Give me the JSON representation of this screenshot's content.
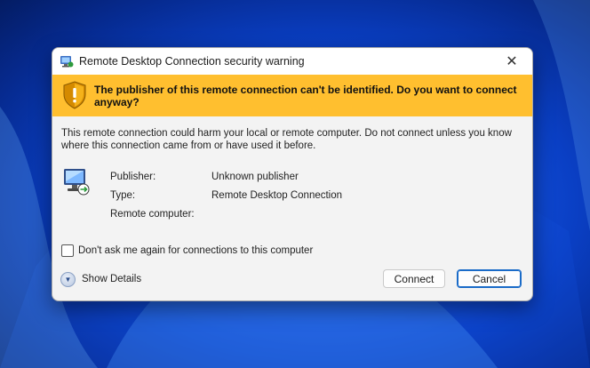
{
  "dialog": {
    "title": "Remote Desktop Connection security warning",
    "close_glyph": "✕",
    "banner_text": "The publisher of this remote connection can't be identified. Do you want to connect anyway?",
    "body_text": "This remote connection could harm your local or remote computer. Do not connect unless you know where this connection came from or have used it before.",
    "details": [
      {
        "label": "Publisher:",
        "value": "Unknown publisher"
      },
      {
        "label": "Type:",
        "value": "Remote Desktop Connection"
      },
      {
        "label": "Remote computer:",
        "value": ""
      }
    ],
    "checkbox_label": "Don't ask me again for connections to this computer",
    "show_details_label": "Show Details",
    "connect_label": "Connect",
    "cancel_label": "Cancel"
  },
  "icons": {
    "title": "remote-desktop-icon",
    "banner": "warning-shield-icon",
    "details": "remote-computer-icon",
    "show_details": "chevron-down-icon",
    "close": "close-icon"
  },
  "colors": {
    "banner": "#ffbf2f",
    "cancel_border": "#1a6bc8",
    "dialog_bg": "#f3f3f3"
  },
  "checkbox_checked": false
}
